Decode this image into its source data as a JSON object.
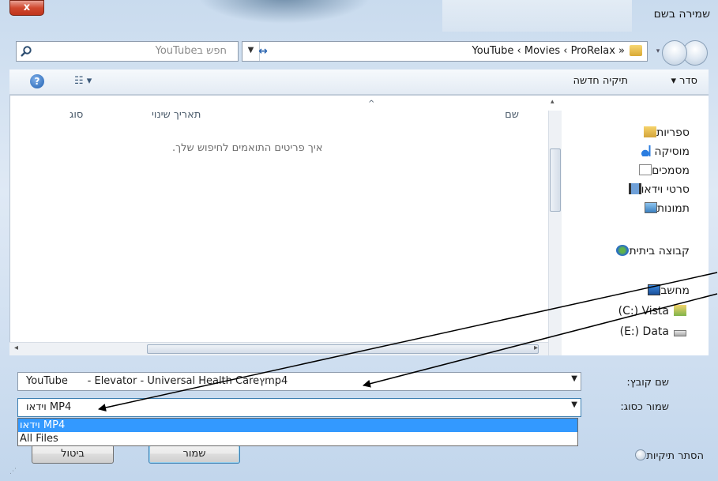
{
  "window": {
    "title": "שמירה בשם",
    "close_label": "x"
  },
  "address": {
    "breadcrumb": [
      "ProRelax",
      "Movies",
      "YouTube"
    ],
    "breadcrumb_text": "YouTube ‹ Movies ‹ ProRelax »"
  },
  "search": {
    "placeholder": "חפש בYouTube"
  },
  "toolbar": {
    "organize": "סדר",
    "new_folder": "תיקיה חדשה"
  },
  "columns": {
    "name": "שם",
    "date_modified": "תאריך שינוי",
    "type": "סוג"
  },
  "content": {
    "empty_message": "איך פריטים התואמים לחיפוש שלך."
  },
  "nav": {
    "libraries": "ספריות",
    "music": "מוסיקה",
    "documents": "מסמכים",
    "videos": "סרטי וידאו",
    "pictures": "תמונות",
    "homegroup": "קבוצה ביתית",
    "computer": "מחשב",
    "drive_c": "(C:) Vista",
    "drive_e": "(E:) Data"
  },
  "form": {
    "filename_label": "שם קובץ:",
    "filename_value": "YouTube      - Elevator - Universal Health Careץmp4",
    "filetype_label": "שמור כסוג:",
    "filetype_value": "וידאו MP4",
    "filetype_options": [
      "וידאו MP4",
      "All Files"
    ]
  },
  "buttons": {
    "save": "שמור",
    "cancel": "ביטול",
    "hide_folders": "הסתר תיקיות"
  },
  "colors": {
    "selection": "#3399ff",
    "frame": "#c9dbee",
    "close": "#c0341c"
  }
}
